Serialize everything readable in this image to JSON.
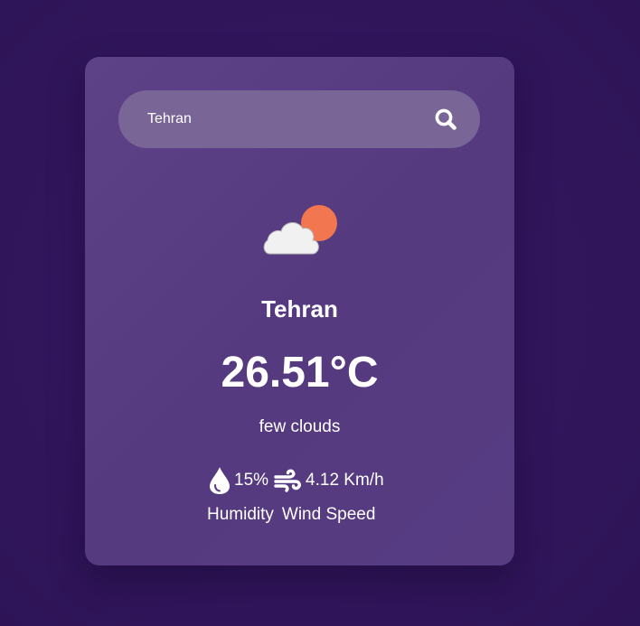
{
  "search": {
    "value": "Tehran",
    "placeholder": ""
  },
  "weather": {
    "icon": "few-clouds-icon",
    "city": "Tehran",
    "temperature": "26.51°C",
    "description": "few clouds"
  },
  "stats": {
    "humidity_value": "15%",
    "humidity_label": "Humidity",
    "wind_value": "4.12 Km/h",
    "wind_label": "Wind Speed",
    "humidity_icon": "water-drop-icon",
    "wind_icon": "wind-icon"
  },
  "colors": {
    "background": "#341760",
    "card": "#573c82",
    "search_bar": "#7a6597",
    "sun": "#f2764f",
    "cloud": "#f1f1f1",
    "text": "#ffffff"
  }
}
